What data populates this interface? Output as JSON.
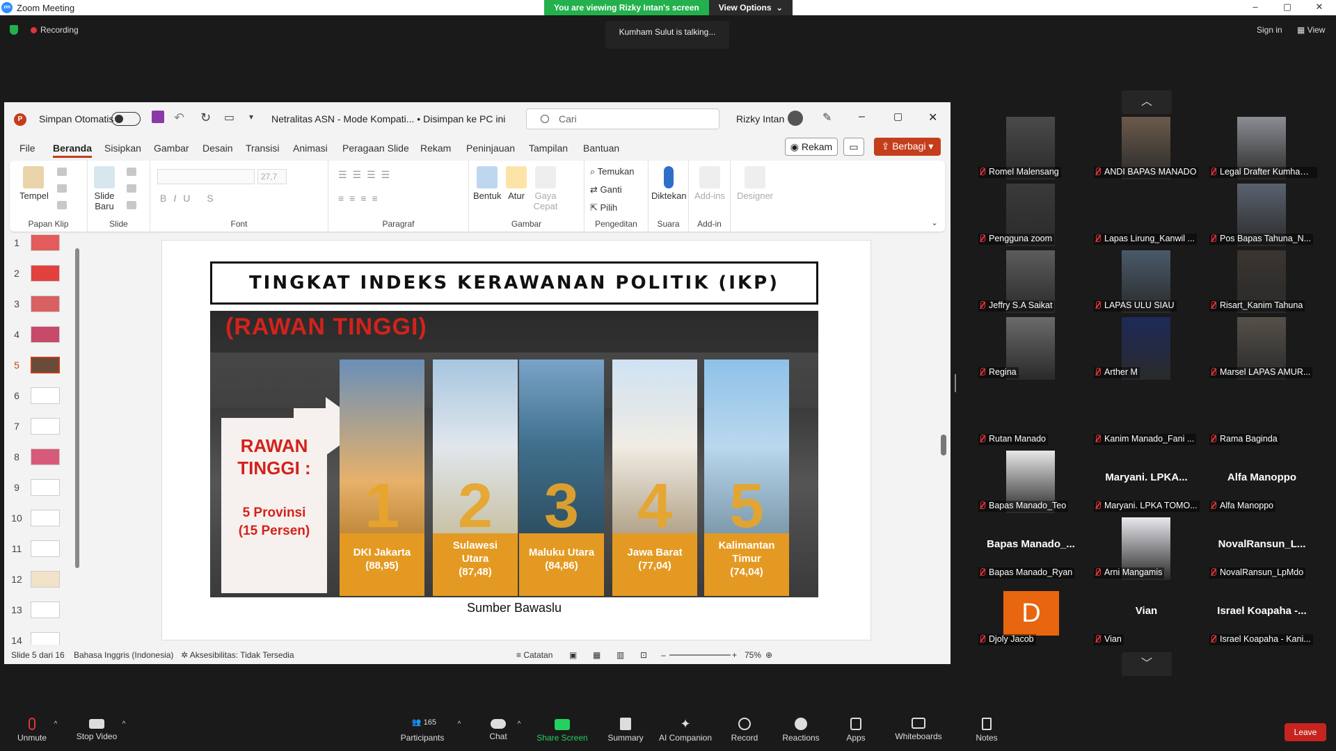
{
  "window": {
    "title": "Zoom Meeting",
    "viewing_banner": "You are viewing Rizky Intan's screen",
    "view_options": "View Options",
    "minimize": "–",
    "restore": "▢",
    "close": "✕"
  },
  "meeting": {
    "recording": "Recording",
    "talking": "Kumham Sulut is talking...",
    "sign_in": "Sign in",
    "view": "View"
  },
  "ppt": {
    "autosave": "Simpan Otomatis",
    "doc_title": "Netralitas ASN  -  Mode Kompati...  •  Disimpan ke PC ini",
    "search_placeholder": "Cari",
    "user": "Rizky Intan",
    "menu": [
      "File",
      "Beranda",
      "Sisipkan",
      "Gambar",
      "Desain",
      "Transisi",
      "Animasi",
      "Peragaan Slide",
      "Rekam",
      "Peninjauan",
      "Tampilan",
      "Bantuan"
    ],
    "rekam_btn": "Rekam",
    "berbagi_btn": "Berbagi",
    "ribbon": {
      "tempel": "Tempel",
      "papan_klip": "Papan Klip",
      "slide_baru_1": "Slide",
      "slide_baru_2": "Baru",
      "slide_group": "Slide",
      "font_size": "27,7",
      "font_group": "Font",
      "paragraf_group": "Paragraf",
      "bentuk": "Bentuk",
      "atur": "Atur",
      "gaya_cepat_1": "Gaya",
      "gaya_cepat_2": "Cepat",
      "gambar_group": "Gambar",
      "temukan": "Temukan",
      "ganti": "Ganti",
      "pilih": "Pilih",
      "pengeditan_group": "Pengeditan",
      "diktekan": "Diktekan",
      "suara_group": "Suara",
      "add_ins": "Add-ins",
      "add_in_group": "Add-in",
      "designer": "Designer"
    },
    "thumbnails": [
      "1",
      "2",
      "3",
      "4",
      "5",
      "6",
      "7",
      "8",
      "9",
      "10",
      "11",
      "12",
      "13",
      "14"
    ],
    "selected_slide": "5",
    "status": {
      "slide": "Slide 5 dari 16",
      "language": "Bahasa Inggris (Indonesia)",
      "accessibility": "Aksesibilitas: Tidak Tersedia",
      "notes": "Catatan",
      "zoom": "75%"
    }
  },
  "slide": {
    "title": "TINGKAT INDEKS KERAWANAN POLITIK (IKP)",
    "banner": "(RAWAN TINGGI)",
    "rawan_1": "RAWAN",
    "rawan_2": "TINGGI :",
    "prov_1": "5 Provinsi",
    "prov_2": "(15 Persen)",
    "provinces": [
      {
        "num": "1",
        "name1": "DKI Jakarta",
        "name2": "(88,95)",
        "name3": ""
      },
      {
        "num": "2",
        "name1": "Sulawesi",
        "name2": "Utara",
        "name3": "(87,48)"
      },
      {
        "num": "3",
        "name1": "Maluku Utara",
        "name2": "(84,86)",
        "name3": ""
      },
      {
        "num": "4",
        "name1": "Jawa Barat",
        "name2": "(77,04)",
        "name3": ""
      },
      {
        "num": "5",
        "name1": "Kalimantan",
        "name2": "Timur",
        "name3": "(74,04)"
      }
    ],
    "source": "Sumber Bawaslu"
  },
  "gallery": {
    "tiles": [
      {
        "name": "Romel Malensang",
        "big": "",
        "video": true
      },
      {
        "name": "ANDI BAPAS MANADO",
        "big": "",
        "video": true
      },
      {
        "name": "Legal Drafter Kumham S...",
        "big": "",
        "video": true
      },
      {
        "name": "Pengguna zoom",
        "big": "",
        "video": true
      },
      {
        "name": "Lapas Lirung_Kanwil ...",
        "big": "",
        "video": false
      },
      {
        "name": "Pos Bapas Tahuna_N...",
        "big": "",
        "video": true
      },
      {
        "name": "Jeffry S.A Saikat",
        "big": "",
        "video": true
      },
      {
        "name": "LAPAS ULU SIAU",
        "big": "",
        "video": true
      },
      {
        "name": "Risart_Kanim Tahuna",
        "big": "",
        "video": true
      },
      {
        "name": "Regina",
        "big": "",
        "video": true
      },
      {
        "name": "Arther M",
        "big": "",
        "video": true
      },
      {
        "name": "Marsel LAPAS AMUR...",
        "big": "",
        "video": true
      },
      {
        "name": "Rutan Manado",
        "big": "",
        "video": false
      },
      {
        "name": "Kanim Manado_Fani ...",
        "big": "",
        "video": false
      },
      {
        "name": "Rama Baginda",
        "big": "",
        "video": false
      },
      {
        "name": "Bapas Manado_Teo",
        "big": "",
        "video": true
      },
      {
        "name": "Maryani. LPKA TOMO...",
        "big": "Maryani.  LPKA...",
        "video": false
      },
      {
        "name": "Alfa Manoppo",
        "big": "Alfa Manoppo",
        "video": false
      },
      {
        "name": "Bapas Manado_Ryan",
        "big": "Bapas  Manado_...",
        "video": false
      },
      {
        "name": "Arni Mangamis",
        "big": "",
        "video": true
      },
      {
        "name": "NovalRansun_LpMdo",
        "big": "NovalRansun_L...",
        "video": false
      },
      {
        "name": "Djoly Jacob",
        "big": "",
        "video": false,
        "avatar": "D"
      },
      {
        "name": "Vian",
        "big": "Vian",
        "video": false
      },
      {
        "name": "Israel Koapaha - Kani...",
        "big": "Israel Koapaha -...",
        "video": false
      }
    ],
    "up": "︿",
    "down": "﹀"
  },
  "toolbar": {
    "unmute": "Unmute",
    "stop_video": "Stop Video",
    "participants": "Participants",
    "participant_count": "165",
    "chat": "Chat",
    "share_screen": "Share Screen",
    "summary": "Summary",
    "ai_companion": "AI Companion",
    "record": "Record",
    "reactions": "Reactions",
    "apps": "Apps",
    "whiteboards": "Whiteboards",
    "notes": "Notes",
    "leave": "Leave"
  },
  "colors": {
    "ppt_accent": "#c43e1c",
    "zoom_green": "#23b14d",
    "rawan_red": "#d3221c",
    "province_orange": "#e49a22",
    "leave_red": "#c8241f"
  }
}
